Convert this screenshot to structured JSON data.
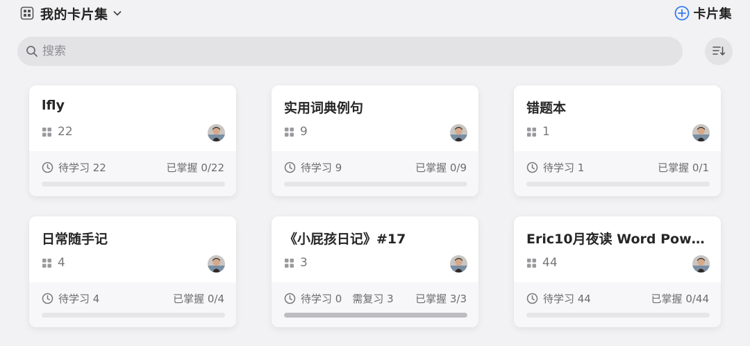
{
  "header": {
    "title": "我的卡片集",
    "add_label": "卡片集"
  },
  "search": {
    "placeholder": "搜索"
  },
  "colors": {
    "accent": "#3478f6",
    "background": "#f2f2f4",
    "card": "#ffffff",
    "card_footer": "#f7f7f9",
    "progress_fill": "#bdbdc1",
    "progress_track": "#e6e6e9"
  },
  "cards": [
    {
      "title": "lfly",
      "count": "22",
      "pending": "待学习 22",
      "review": "",
      "mastered": "已掌握 0/22",
      "progress": 0
    },
    {
      "title": "实用词典例句",
      "count": "9",
      "pending": "待学习 9",
      "review": "",
      "mastered": "已掌握 0/9",
      "progress": 0
    },
    {
      "title": "错题本",
      "count": "1",
      "pending": "待学习 1",
      "review": "",
      "mastered": "已掌握 0/1",
      "progress": 0
    },
    {
      "title": "日常随手记",
      "count": "4",
      "pending": "待学习 4",
      "review": "",
      "mastered": "已掌握 0/4",
      "progress": 0
    },
    {
      "title": "《小屁孩日记》#17",
      "count": "3",
      "pending": "待学习 0",
      "review": "需复习 3",
      "mastered": "已掌握 3/3",
      "progress": 1
    },
    {
      "title": "Eric10月夜读 Word Power...",
      "count": "44",
      "pending": "待学习 44",
      "review": "",
      "mastered": "已掌握 0/44",
      "progress": 0
    }
  ]
}
